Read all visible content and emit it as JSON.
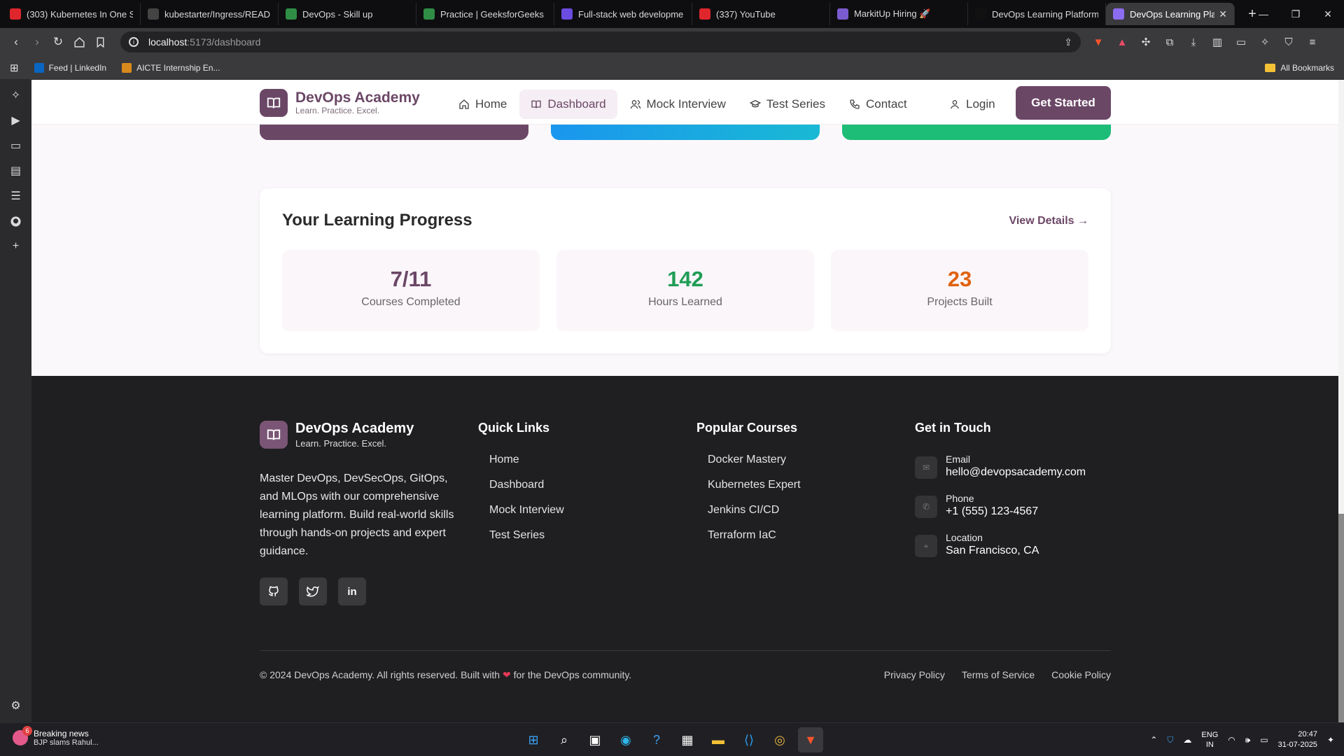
{
  "browser": {
    "tabs": [
      {
        "label": "(303) Kubernetes In One S",
        "icon": "youtube-icon",
        "color": "#e0262d"
      },
      {
        "label": "kubestarter/Ingress/READ",
        "icon": "github-icon",
        "color": "#444444"
      },
      {
        "label": "DevOps - Skill up",
        "icon": "gfg-icon",
        "color": "#2f8d46"
      },
      {
        "label": "Practice | GeeksforGeeks |",
        "icon": "gfg-icon",
        "color": "#2f8d46"
      },
      {
        "label": "Full-stack web developme",
        "icon": "doc-icon",
        "color": "#6b4ce0"
      },
      {
        "label": "(337) YouTube",
        "icon": "youtube-icon",
        "color": "#e0262d"
      },
      {
        "label": "MarkitUp Hiring 🚀",
        "icon": "markitup-icon",
        "color": "#7b5cd0"
      },
      {
        "label": "DevOps Learning Platform",
        "icon": "bolt-icon",
        "color": "#111111"
      },
      {
        "label": "DevOps Learning Plat",
        "icon": "vite-icon",
        "color": "#8c6cf0",
        "active": true
      }
    ],
    "url_host": "localhost",
    "url_path": ":5173/dashboard",
    "bookmarks": [
      {
        "label": "Feed | LinkedIn",
        "icon": "linkedin-icon",
        "color": "#0a66c2"
      },
      {
        "label": "AICTE Internship En...",
        "icon": "aicte-icon",
        "color": "#d98a1c"
      }
    ],
    "all_bookmarks": "All Bookmarks"
  },
  "nav": {
    "brand_name": "DevOps Academy",
    "brand_tagline": "Learn. Practice. Excel.",
    "items": [
      {
        "label": "Home",
        "icon": "home-icon"
      },
      {
        "label": "Dashboard",
        "icon": "book-icon",
        "active": true
      },
      {
        "label": "Mock Interview",
        "icon": "users-icon"
      },
      {
        "label": "Test Series",
        "icon": "graduation-cap-icon"
      },
      {
        "label": "Contact",
        "icon": "phone-icon"
      }
    ],
    "login": "Login",
    "cta": "Get Started"
  },
  "progress": {
    "title": "Your Learning Progress",
    "view_details": "View Details →",
    "stats": [
      {
        "value": "7/11",
        "label": "Courses Completed",
        "color": "#6b4766"
      },
      {
        "value": "142",
        "label": "Hours Learned",
        "color": "#1f9d55"
      },
      {
        "value": "23",
        "label": "Projects Built",
        "color": "#e0620f"
      }
    ]
  },
  "footer": {
    "brand_name": "DevOps Academy",
    "brand_tagline": "Learn. Practice. Excel.",
    "description": "Master DevOps, DevSecOps, GitOps, and MLOps with our comprehensive learning platform. Build real-world skills through hands-on projects and expert guidance.",
    "quick_links_title": "Quick Links",
    "quick_links": [
      "Home",
      "Dashboard",
      "Mock Interview",
      "Test Series"
    ],
    "courses_title": "Popular Courses",
    "courses": [
      "Docker Mastery",
      "Kubernetes Expert",
      "Jenkins CI/CD",
      "Terraform IaC"
    ],
    "contact_title": "Get in Touch",
    "contact": [
      {
        "label": "Email",
        "value": "hello@devopsacademy.com",
        "icon": "mail-icon"
      },
      {
        "label": "Phone",
        "value": "+1 (555) 123-4567",
        "icon": "phone-icon"
      },
      {
        "label": "Location",
        "value": "San Francisco, CA",
        "icon": "map-pin-icon"
      }
    ],
    "copyright_pre": "© 2024 DevOps Academy. All rights reserved. Built with",
    "copyright_post": "for the DevOps community.",
    "legal": [
      "Privacy Policy",
      "Terms of Service",
      "Cookie Policy"
    ]
  },
  "taskbar": {
    "news_title": "Breaking news",
    "news_sub": "BJP slams Rahul...",
    "news_badge": "6",
    "lang_top": "ENG",
    "lang_bottom": "IN",
    "time": "20:47",
    "date": "31-07-2025"
  }
}
